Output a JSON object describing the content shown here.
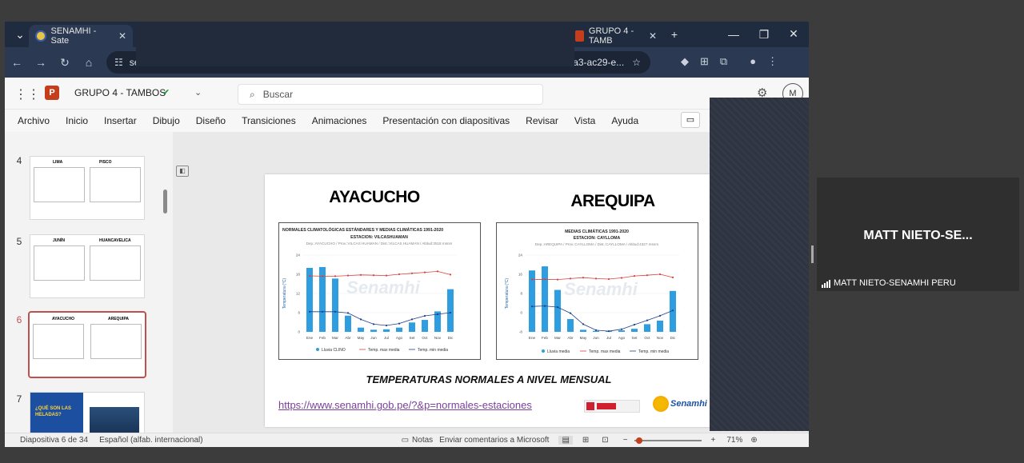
{
  "browser": {
    "tabs": [
      {
        "label": "SENAMHI - Sate"
      },
      {
        "label": "GRUPO 4 - TAMB"
      }
    ],
    "url_visible_start": "se",
    "url_visible_end": "b-38a3-ac29-e..."
  },
  "ppt": {
    "doc_title": "GRUPO 4 - TAMBOS",
    "search_placeholder": "Buscar",
    "avatar_initial": "M",
    "menu": [
      "Archivo",
      "Inicio",
      "Insertar",
      "Dibujo",
      "Diseño",
      "Transiciones",
      "Animaciones",
      "Presentación con diapositivas",
      "Revisar",
      "Vista",
      "Ayuda"
    ]
  },
  "thumbnails": [
    {
      "num": "4",
      "left": "LIMA",
      "right": "PISCO"
    },
    {
      "num": "5",
      "left": "JUNÍN",
      "right": "HUANCAVELICA"
    },
    {
      "num": "6",
      "left": "AYACUCHO",
      "right": "AREQUIPA"
    },
    {
      "num": "7",
      "title": "¿QUÉ SON LAS HELADAS?"
    }
  ],
  "slide": {
    "left_title": "AYACUCHO",
    "right_title": "AREQUIPA",
    "caption": "TEMPERATURAS NORMALES A NIVEL MENSUAL",
    "link": "https://www.senamhi.gob.pe/?&p=normales-estaciones",
    "logo": "Senamhi",
    "watermark": "Senamhi"
  },
  "chart_data": [
    {
      "type": "bar",
      "title": "NORMALES CLIMATOLÓGICAS ESTÁNDARES Y MEDIAS CLIMÁTICAS 1991-2020",
      "subtitle": "ESTACION: VILCASHUAMAN",
      "info": "Dep.:AYACUCHO / Prov.:VILCAS HUAMAN / Dist.:VILCAS HUAMAN / Altitud:3518 msnm",
      "categories": [
        "Ene",
        "Feb",
        "Mar",
        "Abr",
        "May",
        "Jun",
        "Jul",
        "Ago",
        "Set",
        "Oct",
        "Nov",
        "Dic"
      ],
      "ylabel": "Temperatura (°C)",
      "yticks": [
        "24",
        "18",
        "12",
        "6",
        "0"
      ],
      "series": [
        {
          "name": "Lluvia CLINO",
          "values": [
            150,
            152,
            125,
            38,
            10,
            5,
            6,
            10,
            22,
            28,
            48,
            100
          ]
        },
        {
          "name": "Temp. max media",
          "values": [
            17.5,
            17.4,
            17.4,
            17.6,
            17.8,
            17.7,
            17.6,
            18.0,
            18.3,
            18.6,
            18.9,
            17.9
          ]
        },
        {
          "name": "Temp. min media",
          "values": [
            6.3,
            6.3,
            6.3,
            5.9,
            3.9,
            2.4,
            2.0,
            2.6,
            3.9,
            5.0,
            5.5,
            6.0
          ]
        }
      ]
    },
    {
      "type": "bar",
      "title": "MEDIAS CLIMÁTICAS 1991-2020",
      "subtitle": "ESTACION: CAYLLOMA",
      "info": "Dep.:AREQUIPA / Prov.:CAYLLOMA / Dist.:CAYLLOMA / Altitud:4327 msnm",
      "categories": [
        "Ene",
        "Feb",
        "Mar",
        "Abr",
        "May",
        "Jun",
        "Jul",
        "Ago",
        "Set",
        "Oct",
        "Nov",
        "Dic"
      ],
      "ylabel": "Temperatura (°C)",
      "yticks": [
        "24",
        "16",
        "8",
        "0",
        "-8"
      ],
      "series": [
        {
          "name": "Lluvia media",
          "values": [
            120,
            128,
            82,
            25,
            4,
            2,
            2,
            3,
            6,
            15,
            22,
            80
          ]
        },
        {
          "name": "Temp. max media",
          "values": [
            13.8,
            13.9,
            13.8,
            14.2,
            14.6,
            14.2,
            14.0,
            14.5,
            15.3,
            15.6,
            16.0,
            14.7
          ]
        },
        {
          "name": "Temp. min media",
          "values": [
            2.6,
            2.8,
            2.3,
            -0.2,
            -4.8,
            -7.3,
            -7.7,
            -6.9,
            -5.0,
            -3.2,
            -1.3,
            0.9
          ]
        }
      ]
    }
  ],
  "status": {
    "slide_info": "Diapositiva 6 de 34",
    "language": "Español (alfab. internacional)",
    "notes": "Notas",
    "feedback": "Enviar comentarios a Microsoft",
    "zoom": "71%"
  },
  "video": {
    "short_name": "MATT  NIETO-SE...",
    "full_name": "MATT NIETO-SENAMHI PERU"
  }
}
